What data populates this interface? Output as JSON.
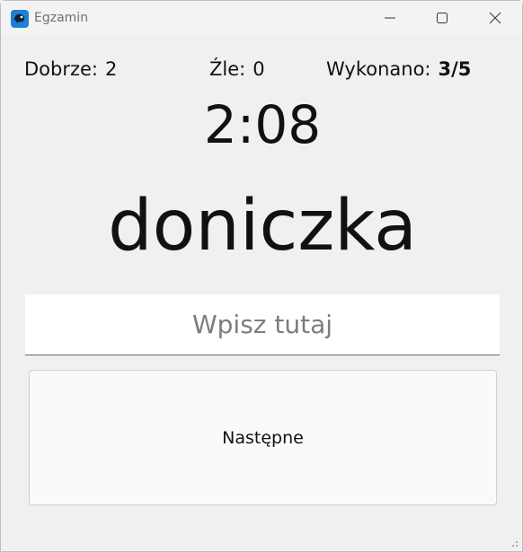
{
  "window": {
    "title": "Egzamin",
    "app_icon": "app-logo-icon",
    "controls": [
      "minimize-icon",
      "maximize-icon",
      "close-icon"
    ]
  },
  "stats": {
    "correct_label": "Dobrze:",
    "correct_value": "2",
    "wrong_label": "Źle:",
    "wrong_value": "0",
    "done_label": "Wykonano:",
    "done_value": "3/5"
  },
  "timer": "2:08",
  "word": "doniczka",
  "answer": {
    "value": "",
    "placeholder": "Wpisz tutaj"
  },
  "next_button_label": "Następne"
}
